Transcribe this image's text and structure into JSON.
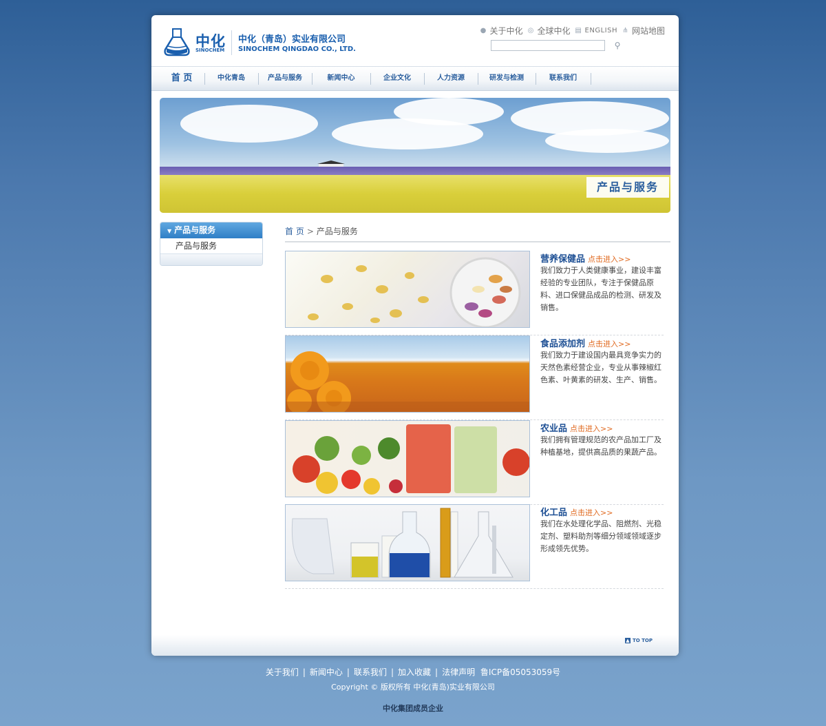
{
  "logo": {
    "cn": "中化",
    "en": "SINOCHEM"
  },
  "company": {
    "cn": "中化（青岛）实业有限公司",
    "en": "SINOCHEM QINGDAO CO., LTD."
  },
  "top_links": {
    "about": "关于中化",
    "global": "全球中化",
    "english": "ENGLISH",
    "sitemap": "网站地图"
  },
  "search": {
    "value": "",
    "placeholder": ""
  },
  "nav": [
    "首 页",
    "中化青岛",
    "产品与服务",
    "新闻中心",
    "企业文化",
    "人力资源",
    "研发与检测",
    "联系我们"
  ],
  "banner": {
    "label": "产品与服务"
  },
  "sidebar": {
    "title": "产品与服务",
    "items": [
      "产品与服务"
    ]
  },
  "breadcrumb": {
    "home": "首 页",
    "separator": ">",
    "current": "产品与服务"
  },
  "more_label": "点击进入>>",
  "products": [
    {
      "title": "营养保健品",
      "desc": "我们致力于人类健康事业，建设丰富经验的专业团队，专注于保健品原料、进口保健品成品的检测、研发及销售。"
    },
    {
      "title": "食品添加剂",
      "desc": "我们致力于建设国内最具竞争实力的天然色素经营企业，专业从事辣椒红色素、叶黄素的研发、生产、销售。"
    },
    {
      "title": "农业品",
      "desc": "我们拥有管理规范的农产品加工厂及种植基地，提供高品质的果蔬产品。"
    },
    {
      "title": "化工品",
      "desc": "我们在水处理化学品、阻燃剂、光稳定剂、塑料助剂等细分领域领域逐步形成领先优势。"
    }
  ],
  "to_top": "TO TOP",
  "footer": {
    "links": [
      "关于我们",
      "新闻中心",
      "联系我们",
      "加入收藏",
      "法律声明"
    ],
    "icp": "鲁ICP备05053059号",
    "copyright": "Copyright © 版权所有  中化(青岛)实业有限公司",
    "member": "中化集团成员企业"
  },
  "colors": {
    "brand": "#1a5fae",
    "accent": "#e0691f",
    "nav_text": "#2b5f9e",
    "background": "#4b78ad"
  }
}
